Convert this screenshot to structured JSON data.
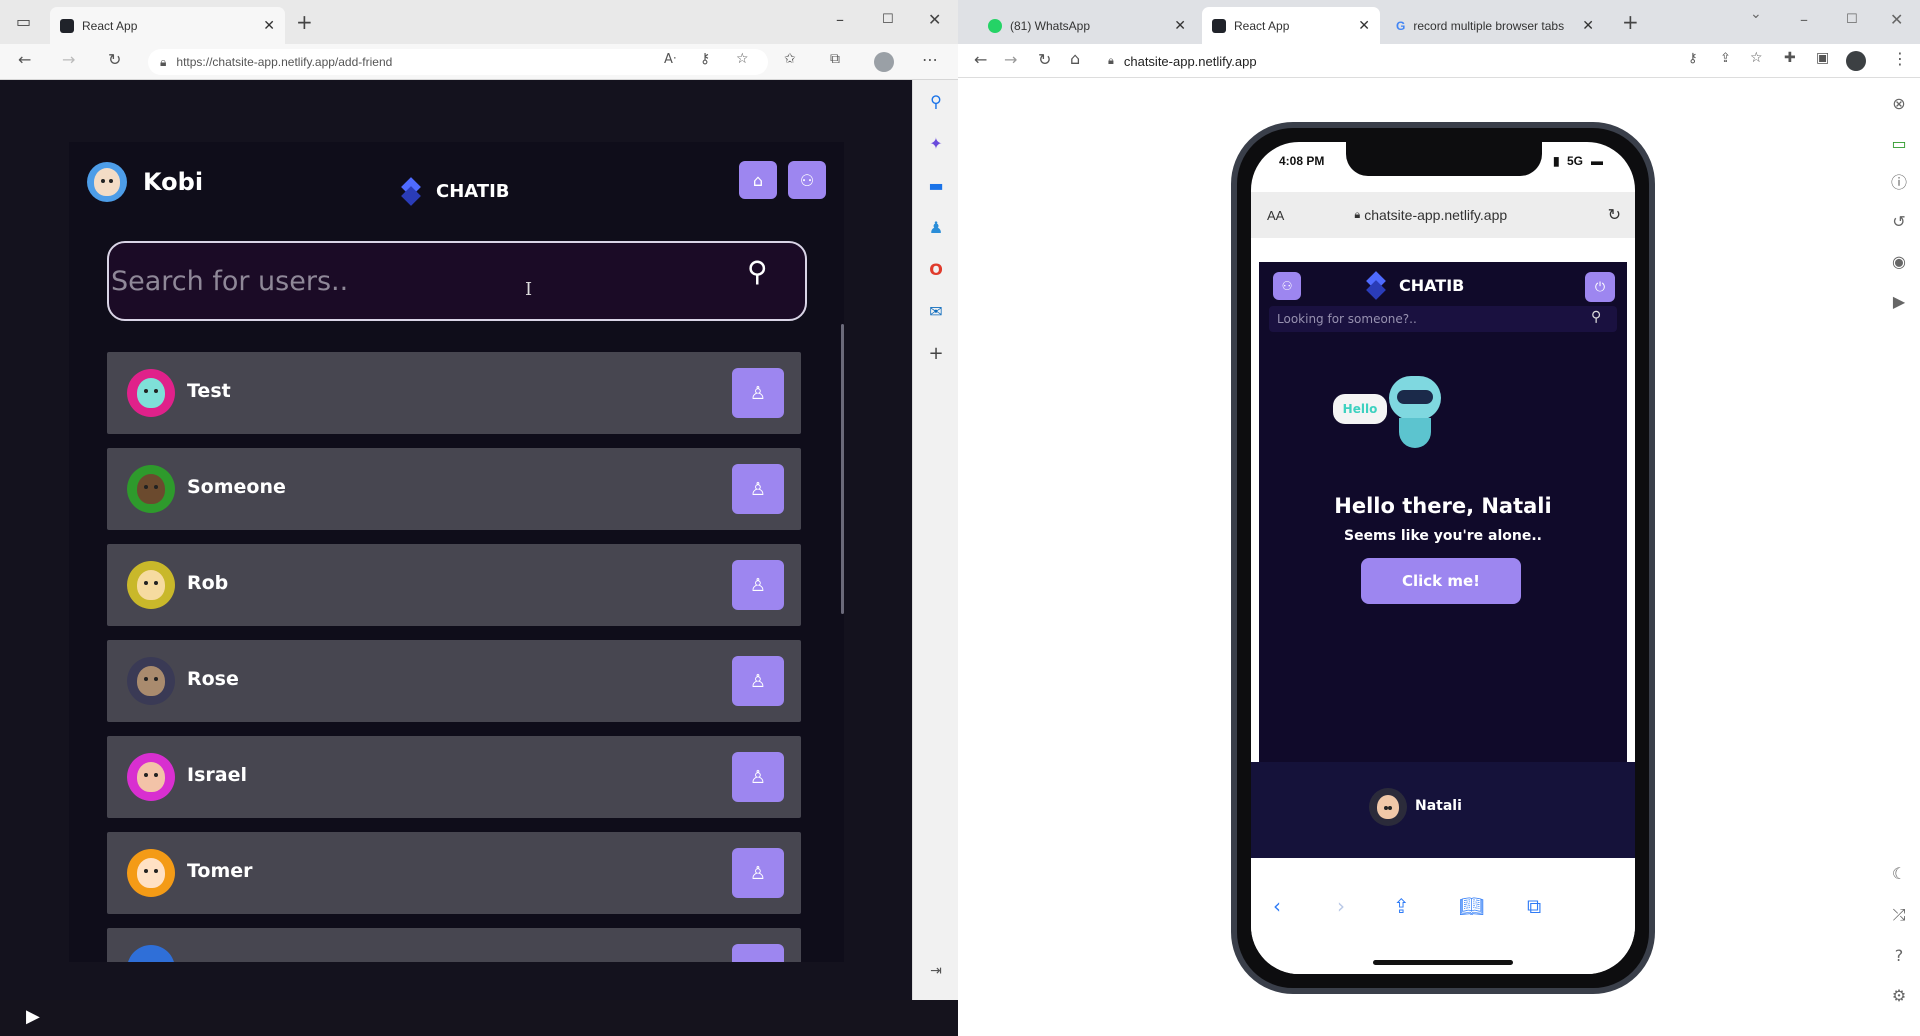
{
  "left_window": {
    "tab": {
      "title": "React App"
    },
    "url": "https://chatsite-app.netlify.app/add-friend",
    "app": {
      "user_name": "Kobi",
      "brand": "CHATIB",
      "search_placeholder": "Search for users..",
      "users": [
        {
          "name": "Test",
          "avatar_color": "#e0218a",
          "face_color": "#7fe0d8"
        },
        {
          "name": "Someone",
          "avatar_color": "#2e9a2c",
          "face_color": "#6b4a2e"
        },
        {
          "name": "Rob",
          "avatar_color": "#c9b82a",
          "face_color": "#f6dba0"
        },
        {
          "name": "Rose",
          "avatar_color": "#3a3a55",
          "face_color": "#a98b6e"
        },
        {
          "name": "Israel",
          "avatar_color": "#d82fd0",
          "face_color": "#f3c3a8"
        },
        {
          "name": "Tomer",
          "avatar_color": "#f49b16",
          "face_color": "#ffe1c4"
        }
      ]
    }
  },
  "right_window": {
    "tabs": [
      {
        "title": "(81) WhatsApp"
      },
      {
        "title": "React App"
      },
      {
        "title": "record multiple browser tabs"
      }
    ],
    "url": "chatsite-app.netlify.app",
    "phone": {
      "time": "4:08 PM",
      "network": "5G",
      "reader_mode": "AA",
      "url": "chatsite-app.netlify.app",
      "brand": "CHATIB",
      "search_placeholder": "Looking for someone?..",
      "bubble_text": "Hello",
      "heading": "Hello there, Natali",
      "subheading": "Seems like you're alone..",
      "button_label": "Click me!",
      "current_user": "Natali"
    }
  },
  "colors": {
    "accent": "#9d86f0",
    "app_bg": "#0f0d1a",
    "row_bg": "#474650"
  }
}
